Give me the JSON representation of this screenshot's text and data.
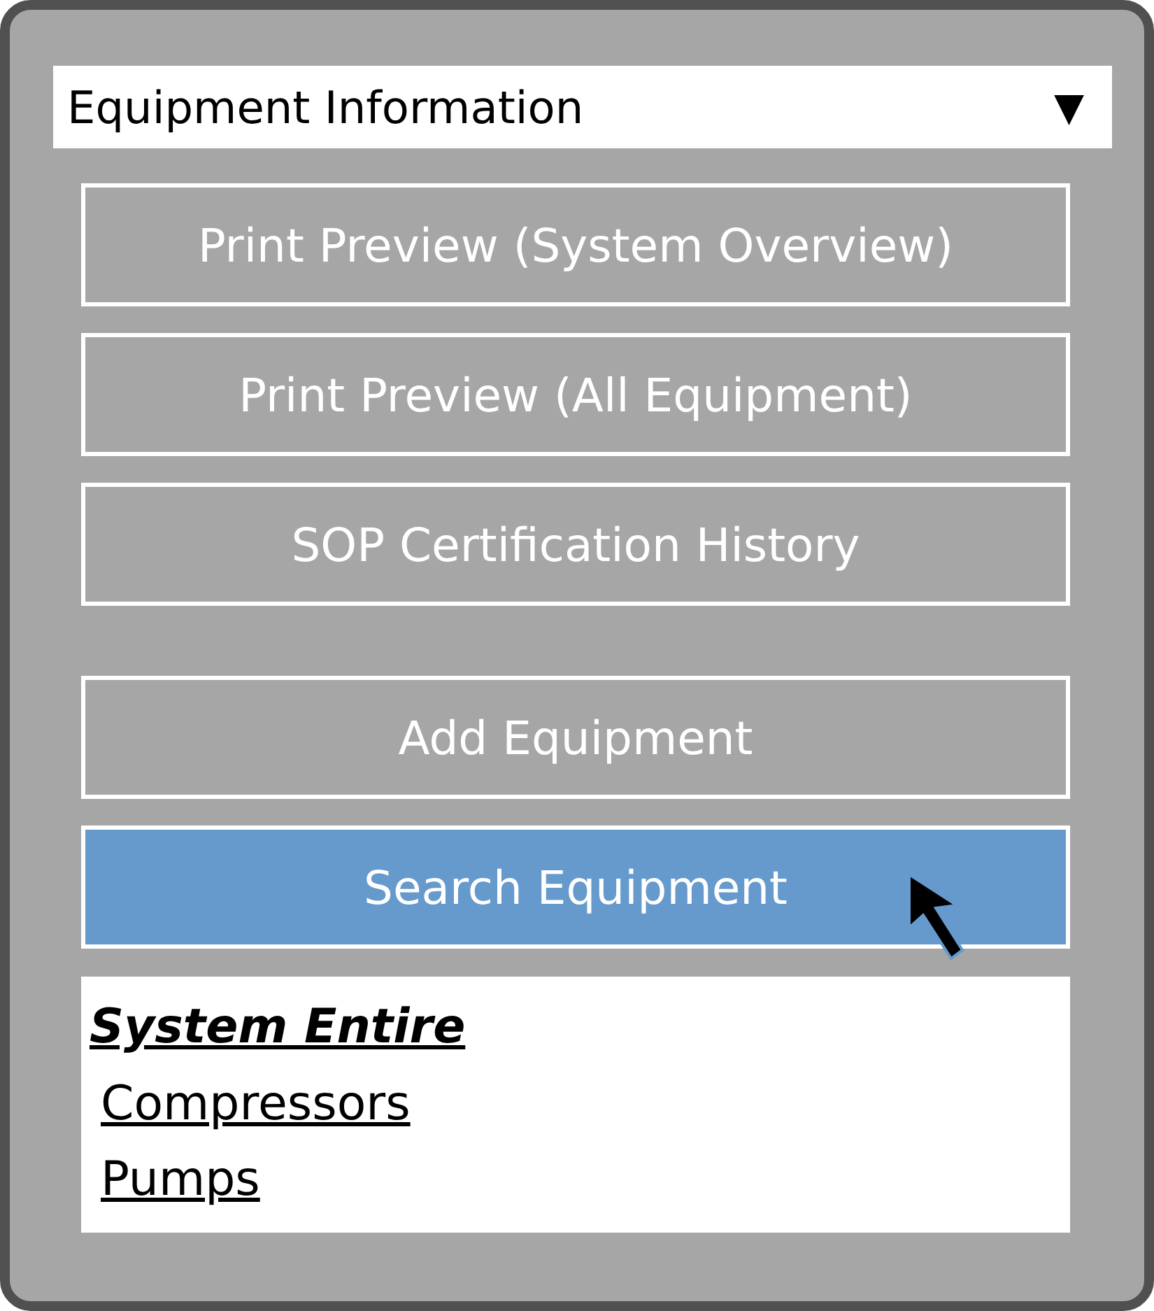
{
  "dropdown": {
    "value": "Equipment Information",
    "caret": "▼"
  },
  "button_groups": [
    [
      {
        "label": "Print Preview (System Overview)",
        "selected": false
      },
      {
        "label": "Print Preview (All Equipment)",
        "selected": false
      },
      {
        "label": "SOP Certification History",
        "selected": false
      }
    ],
    [
      {
        "label": "Add Equipment",
        "selected": false
      },
      {
        "label": "Search Equipment",
        "selected": true
      }
    ]
  ],
  "tree": [
    {
      "label": "System Entire",
      "children": [
        {
          "label": "Compressors"
        },
        {
          "label": "Pumps"
        }
      ]
    }
  ]
}
